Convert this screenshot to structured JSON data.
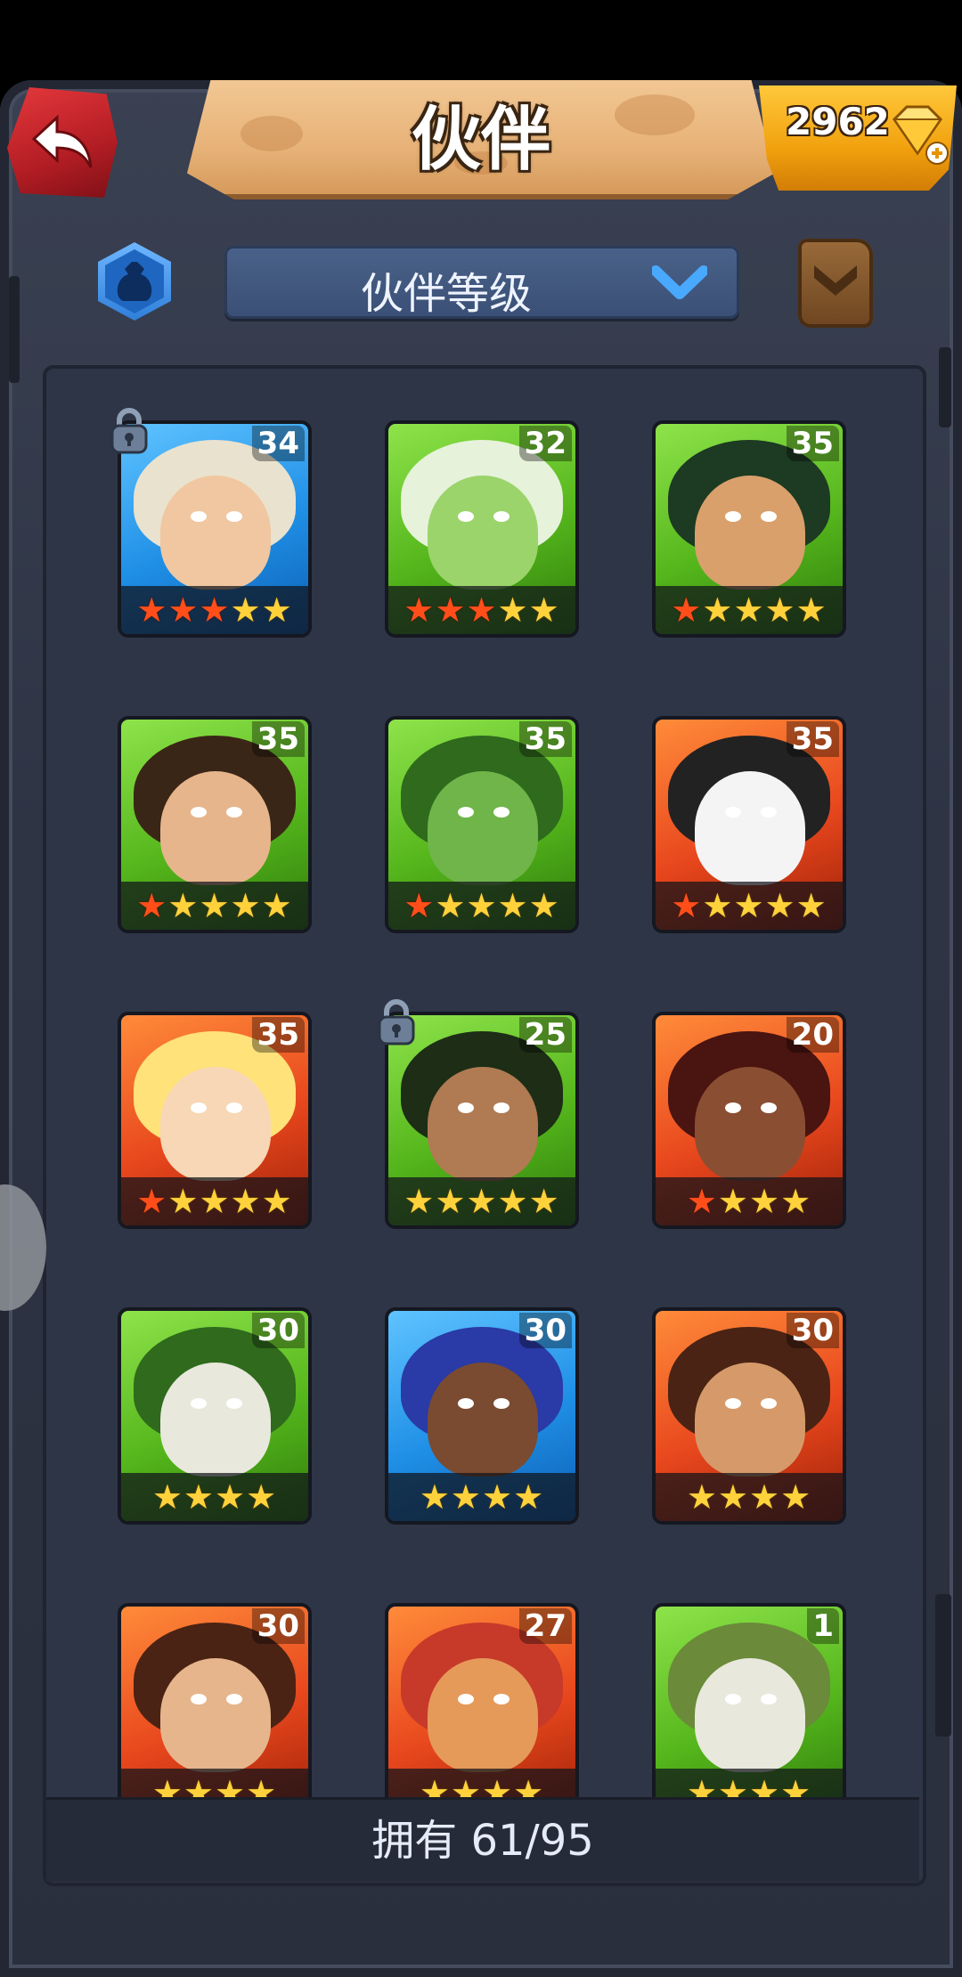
{
  "header": {
    "title": "伙伴",
    "gems": "2962",
    "back_icon": "back-arrow-icon",
    "gem_icon": "diamond-plus-icon"
  },
  "toolbar": {
    "sort_label": "伙伴等级",
    "filter_icon": "bag-filter-icon",
    "codex_icon": "leather-book-icon"
  },
  "companions": [
    {
      "level": "34",
      "stars": [
        "red",
        "red",
        "red",
        "gold",
        "gold",
        "gold"
      ],
      "bg": "blue",
      "locked": true
    },
    {
      "level": "32",
      "stars": [
        "red",
        "red",
        "red",
        "gold",
        "gold"
      ],
      "bg": "green",
      "locked": false
    },
    {
      "level": "35",
      "stars": [
        "red",
        "gold",
        "gold",
        "gold",
        "gold"
      ],
      "bg": "green",
      "locked": false
    },
    {
      "level": "35",
      "stars": [
        "red",
        "gold",
        "gold",
        "gold",
        "gold"
      ],
      "bg": "green",
      "locked": false
    },
    {
      "level": "35",
      "stars": [
        "red",
        "gold",
        "gold",
        "gold",
        "gold"
      ],
      "bg": "green",
      "locked": false
    },
    {
      "level": "35",
      "stars": [
        "red",
        "gold",
        "gold",
        "gold",
        "gold"
      ],
      "bg": "red",
      "locked": false
    },
    {
      "level": "35",
      "stars": [
        "red",
        "gold",
        "gold",
        "gold",
        "gold"
      ],
      "bg": "red",
      "locked": false
    },
    {
      "level": "25",
      "stars": [
        "gold",
        "gold",
        "gold",
        "gold",
        "gold"
      ],
      "bg": "green",
      "locked": true
    },
    {
      "level": "20",
      "stars": [
        "red",
        "gold",
        "gold",
        "gold"
      ],
      "bg": "red",
      "locked": false
    },
    {
      "level": "30",
      "stars": [
        "gold",
        "gold",
        "gold",
        "gold"
      ],
      "bg": "green",
      "locked": false
    },
    {
      "level": "30",
      "stars": [
        "gold",
        "gold",
        "gold",
        "gold"
      ],
      "bg": "blue",
      "locked": false
    },
    {
      "level": "30",
      "stars": [
        "gold",
        "gold",
        "gold",
        "gold"
      ],
      "bg": "red",
      "locked": false
    },
    {
      "level": "30",
      "stars": [
        "gold",
        "gold",
        "gold",
        "gold"
      ],
      "bg": "red",
      "locked": false
    },
    {
      "level": "27",
      "stars": [
        "gold",
        "gold",
        "gold",
        "gold"
      ],
      "bg": "red",
      "locked": false
    },
    {
      "level": "1",
      "stars": [
        "gold",
        "gold",
        "gold",
        "gold"
      ],
      "bg": "green",
      "locked": false
    }
  ],
  "footer": {
    "owned_text": "拥有 61/95"
  },
  "colors": {
    "blue": "#1f8fe6",
    "green": "#55b61c",
    "red": "#e8471d"
  }
}
